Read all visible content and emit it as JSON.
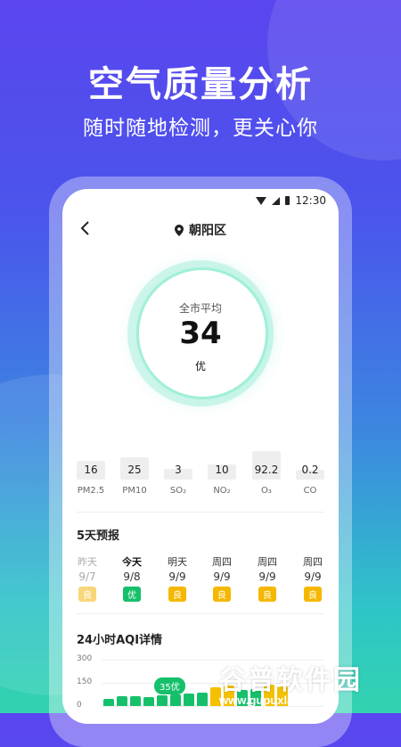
{
  "promo": {
    "title": "空气质量分析",
    "subtitle": "随时随地检测，更关心你"
  },
  "status_bar": {
    "time": "12:30"
  },
  "nav": {
    "location": "朝阳区"
  },
  "aqi": {
    "label": "全市平均",
    "value": "34",
    "grade": "优"
  },
  "pollutants": [
    {
      "name": "PM2.5",
      "value": "16",
      "level": 0.32
    },
    {
      "name": "PM10",
      "value": "25",
      "level": 0.42
    },
    {
      "name": "SO₂",
      "value": "3",
      "level": 0.1
    },
    {
      "name": "NO₂",
      "value": "10",
      "level": 0.22
    },
    {
      "name": "O₃",
      "value": "92.2",
      "level": 0.6
    },
    {
      "name": "CO",
      "value": "0.2",
      "level": 0.08
    }
  ],
  "forecast": {
    "title": "5天预报",
    "days": [
      {
        "name": "昨天",
        "date": "9/7",
        "grade": "良",
        "color": "#f7d77a"
      },
      {
        "name": "今天",
        "date": "9/8",
        "grade": "优",
        "color": "#16c06b"
      },
      {
        "name": "明天",
        "date": "9/9",
        "grade": "良",
        "color": "#f5b800"
      },
      {
        "name": "周四",
        "date": "9/9",
        "grade": "良",
        "color": "#f5b800"
      },
      {
        "name": "周四",
        "date": "9/9",
        "grade": "良",
        "color": "#f5b800"
      },
      {
        "name": "周四",
        "date": "9/9",
        "grade": "良",
        "color": "#f5b800"
      }
    ]
  },
  "hourly": {
    "title": "24小时AQI详情",
    "y_ticks": [
      "300",
      "150",
      "0"
    ],
    "tooltip": "35优",
    "values": [
      20,
      28,
      30,
      26,
      32,
      35,
      38,
      40,
      55,
      60,
      48,
      50,
      62,
      58
    ],
    "colors": {
      "good": "#16c06b",
      "moderate": "#f5c000"
    }
  },
  "watermark": {
    "title": "谷普软件园",
    "url": "www.gupuxlazal.com"
  }
}
